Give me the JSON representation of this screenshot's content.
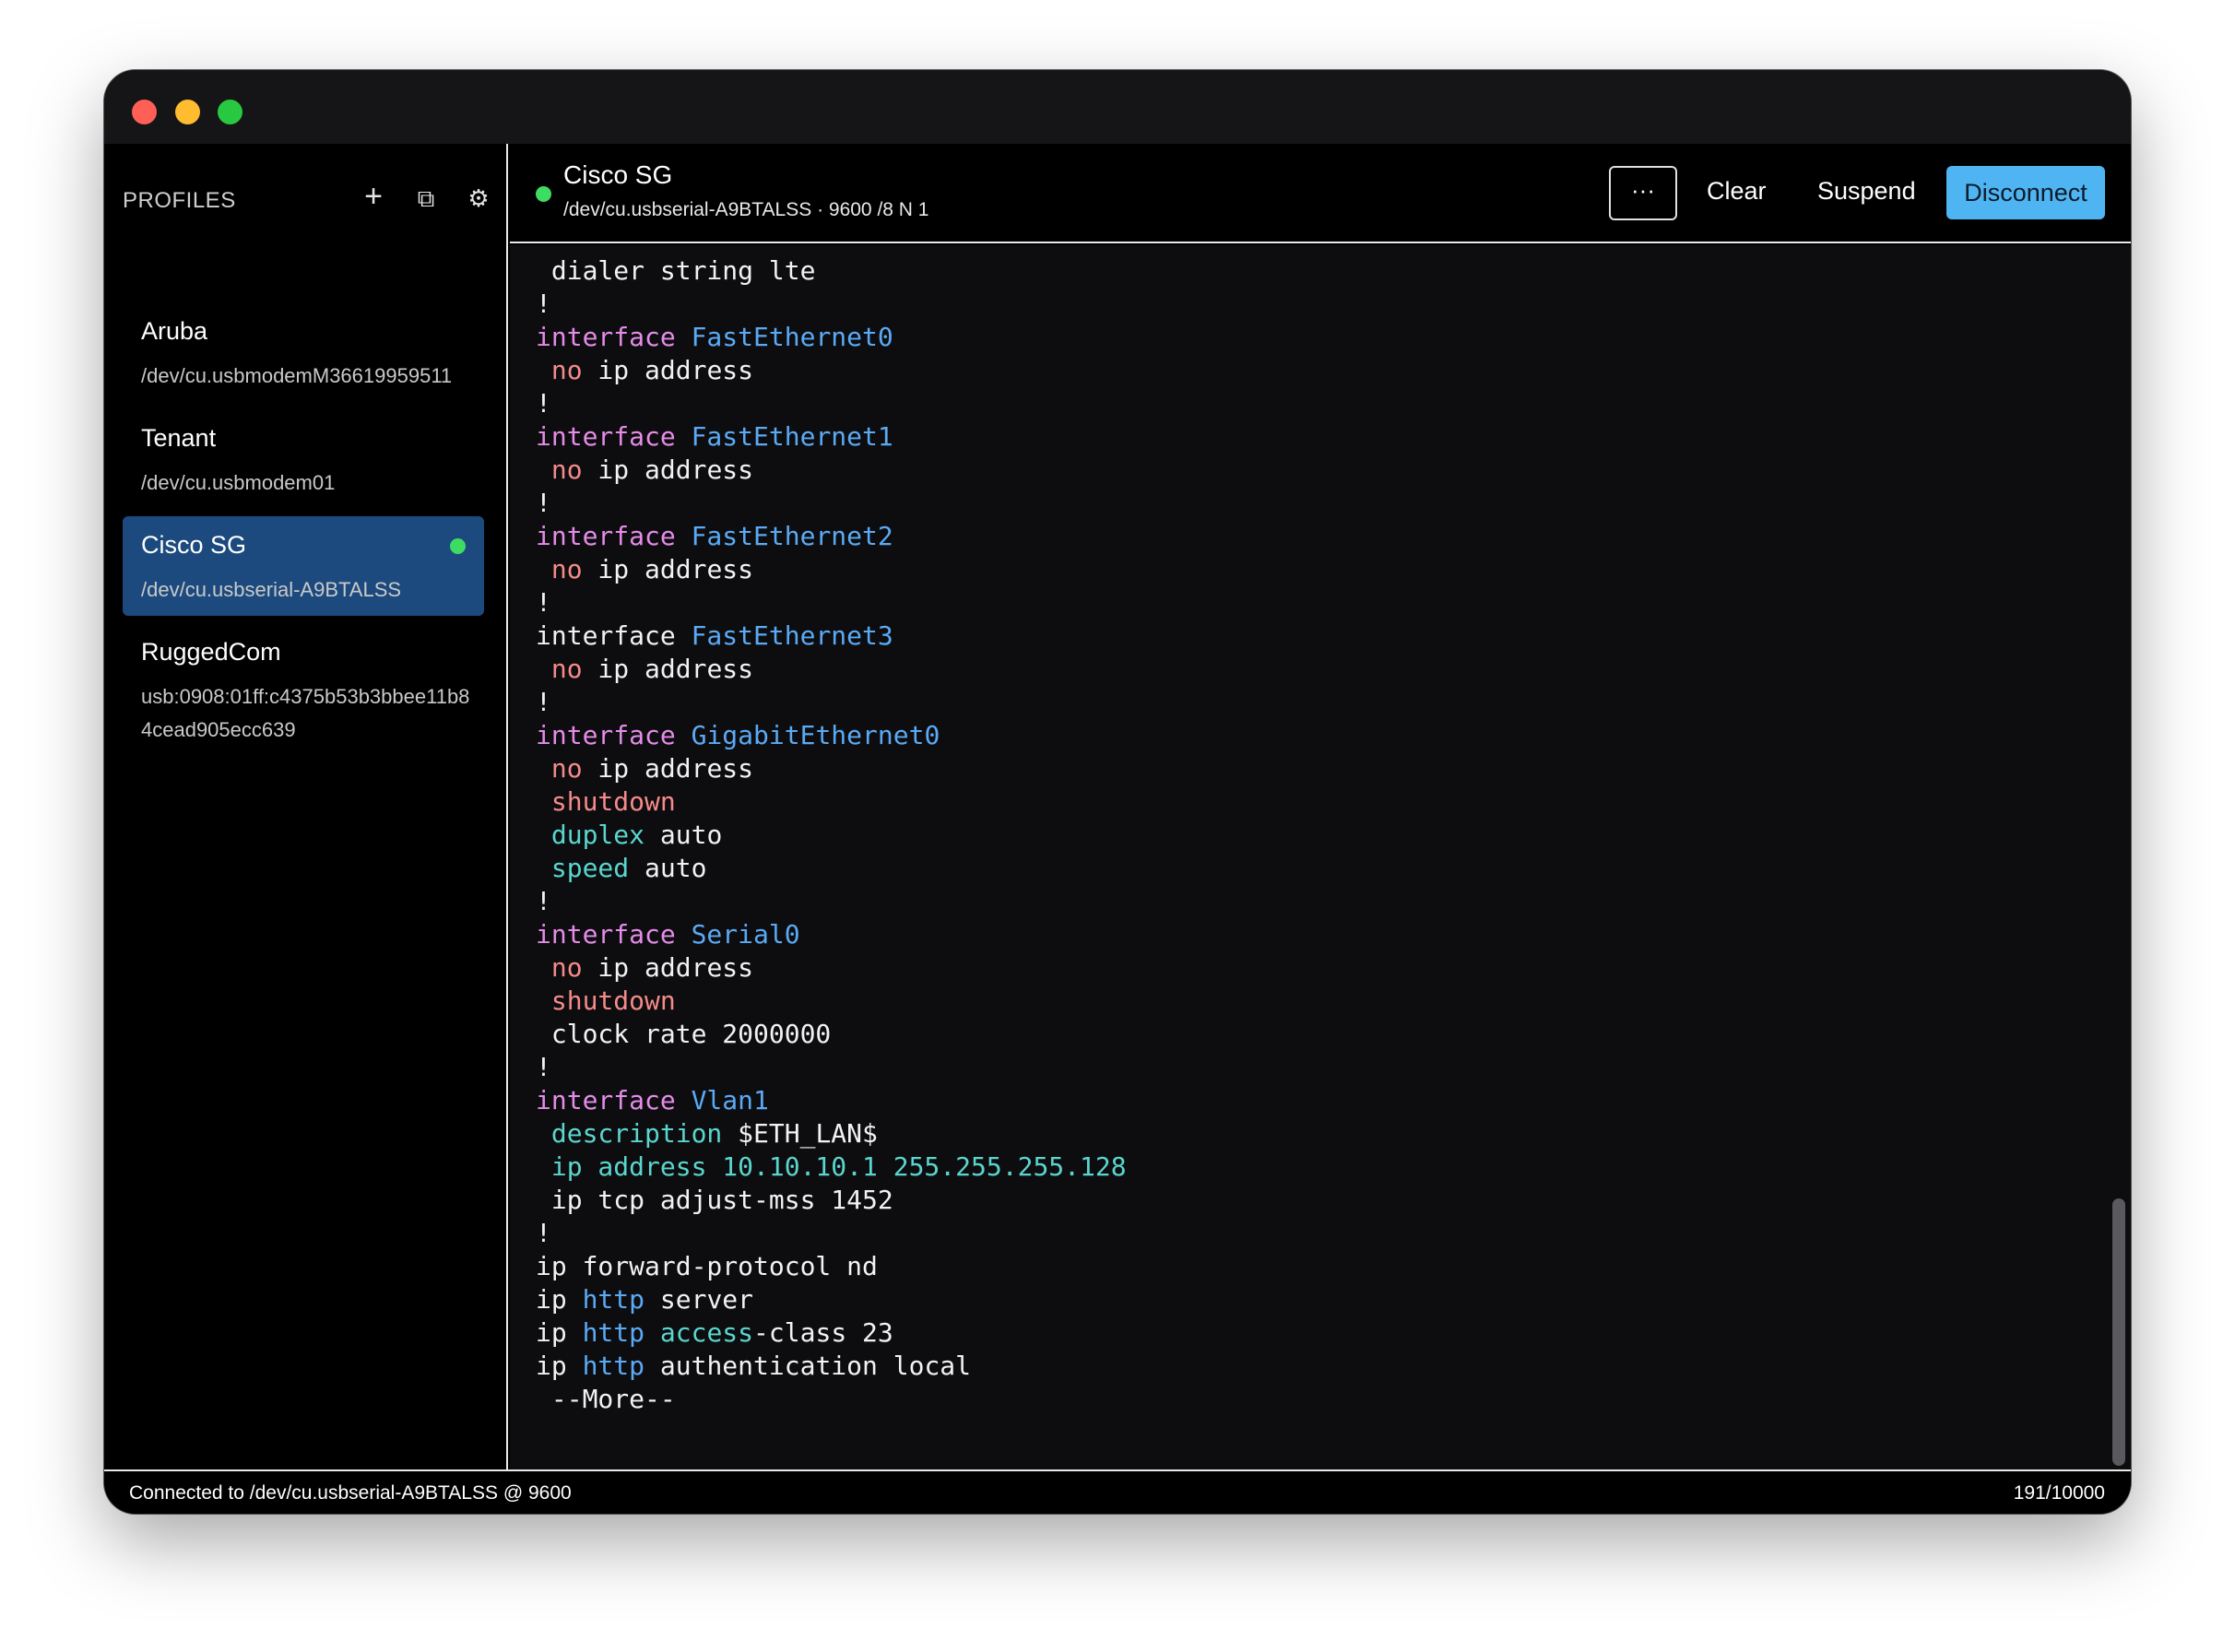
{
  "window": {
    "traffic_lights": [
      "close",
      "minimize",
      "zoom"
    ]
  },
  "sidebar": {
    "title": "PROFILES",
    "actions": {
      "add_icon": "+",
      "duplicate_icon": "⧉",
      "settings_icon": "⚙"
    },
    "profiles": [
      {
        "name": "Aruba",
        "path": "/dev/cu.usbmodemM36619959511",
        "active": false,
        "connected": false
      },
      {
        "name": "Tenant",
        "path": "/dev/cu.usbmodem01",
        "active": false,
        "connected": false
      },
      {
        "name": "Cisco SG",
        "path": "/dev/cu.usbserial-A9BTALSS",
        "active": true,
        "connected": true
      },
      {
        "name": "RuggedCom",
        "path": "usb:0908:01ff:c4375b53b3bbee11b84cead905ecc639",
        "active": false,
        "connected": false
      }
    ]
  },
  "header": {
    "title": "Cisco SG",
    "subtitle": "/dev/cu.usbserial-A9BTALSS · 9600 /8 N 1",
    "more_label": "···",
    "clear_label": "Clear",
    "suspend_label": "Suspend",
    "disconnect_label": "Disconnect"
  },
  "terminal": {
    "lines": [
      [
        {
          "t": " dialer string lte",
          "c": ""
        }
      ],
      [
        {
          "t": "!",
          "c": ""
        }
      ],
      [
        {
          "t": "interface ",
          "c": "kw"
        },
        {
          "t": "FastEthernet0",
          "c": "if"
        }
      ],
      [
        {
          "t": " ",
          "c": ""
        },
        {
          "t": "no",
          "c": "no"
        },
        {
          "t": " ip address",
          "c": ""
        }
      ],
      [
        {
          "t": "!",
          "c": ""
        }
      ],
      [
        {
          "t": "interface ",
          "c": "kw"
        },
        {
          "t": "FastEthernet1",
          "c": "if"
        }
      ],
      [
        {
          "t": " ",
          "c": ""
        },
        {
          "t": "no",
          "c": "no"
        },
        {
          "t": " ip address",
          "c": ""
        }
      ],
      [
        {
          "t": "!",
          "c": ""
        }
      ],
      [
        {
          "t": "interface ",
          "c": "kw"
        },
        {
          "t": "FastEthernet2",
          "c": "if"
        }
      ],
      [
        {
          "t": " ",
          "c": ""
        },
        {
          "t": "no",
          "c": "no"
        },
        {
          "t": " ip address",
          "c": ""
        }
      ],
      [
        {
          "t": "!",
          "c": ""
        }
      ],
      [
        {
          "t": "interface ",
          "c": ""
        },
        {
          "t": "FastEthernet3",
          "c": "if"
        }
      ],
      [
        {
          "t": " ",
          "c": ""
        },
        {
          "t": "no",
          "c": "no"
        },
        {
          "t": " ip address",
          "c": ""
        }
      ],
      [
        {
          "t": "!",
          "c": ""
        }
      ],
      [
        {
          "t": "interface ",
          "c": "kw"
        },
        {
          "t": "GigabitEthernet0",
          "c": "if"
        }
      ],
      [
        {
          "t": " ",
          "c": ""
        },
        {
          "t": "no",
          "c": "no"
        },
        {
          "t": " ip address",
          "c": ""
        }
      ],
      [
        {
          "t": " ",
          "c": ""
        },
        {
          "t": "shutdown",
          "c": "no"
        }
      ],
      [
        {
          "t": " ",
          "c": ""
        },
        {
          "t": "duplex",
          "c": "cy"
        },
        {
          "t": " auto",
          "c": ""
        }
      ],
      [
        {
          "t": " ",
          "c": ""
        },
        {
          "t": "speed",
          "c": "cy"
        },
        {
          "t": " auto",
          "c": ""
        }
      ],
      [
        {
          "t": "!",
          "c": ""
        }
      ],
      [
        {
          "t": "interface ",
          "c": "kw"
        },
        {
          "t": "Serial0",
          "c": "if"
        }
      ],
      [
        {
          "t": " ",
          "c": ""
        },
        {
          "t": "no",
          "c": "no"
        },
        {
          "t": " ip address",
          "c": ""
        }
      ],
      [
        {
          "t": " ",
          "c": ""
        },
        {
          "t": "shutdown",
          "c": "no"
        }
      ],
      [
        {
          "t": " clock rate 2000000",
          "c": ""
        }
      ],
      [
        {
          "t": "!",
          "c": ""
        }
      ],
      [
        {
          "t": "interface ",
          "c": "kw"
        },
        {
          "t": "Vlan1",
          "c": "if"
        }
      ],
      [
        {
          "t": " ",
          "c": ""
        },
        {
          "t": "description",
          "c": "cy"
        },
        {
          "t": " $ETH_LAN$",
          "c": ""
        }
      ],
      [
        {
          "t": " ip address 10.10.10.1 255.255.255.128",
          "c": "cy"
        }
      ],
      [
        {
          "t": " ip tcp adjust-mss 1452",
          "c": ""
        }
      ],
      [
        {
          "t": "!",
          "c": ""
        }
      ],
      [
        {
          "t": "ip forward-protocol nd",
          "c": ""
        }
      ],
      [
        {
          "t": "ip ",
          "c": ""
        },
        {
          "t": "http",
          "c": "if"
        },
        {
          "t": " server",
          "c": ""
        }
      ],
      [
        {
          "t": "ip ",
          "c": ""
        },
        {
          "t": "http",
          "c": "if"
        },
        {
          "t": " ",
          "c": ""
        },
        {
          "t": "access",
          "c": "cy"
        },
        {
          "t": "-class 23",
          "c": ""
        }
      ],
      [
        {
          "t": "ip ",
          "c": ""
        },
        {
          "t": "http",
          "c": "if"
        },
        {
          "t": " authentication local",
          "c": ""
        }
      ],
      [
        {
          "t": " --More--",
          "c": ""
        }
      ]
    ]
  },
  "status": {
    "left": "Connected to /dev/cu.usbserial-A9BTALSS @ 9600",
    "right": "191/10000"
  }
}
